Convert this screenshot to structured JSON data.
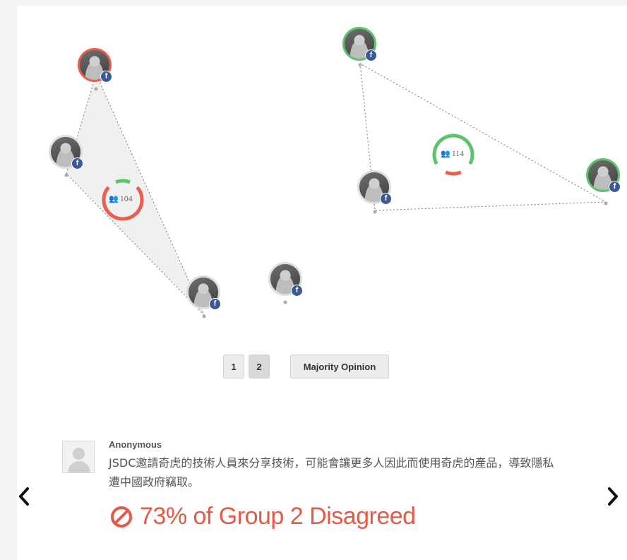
{
  "groups": [
    {
      "id": "g1",
      "count": "104",
      "agree_frac": 0.12,
      "disagree_frac": 0.73
    },
    {
      "id": "g2",
      "count": "114",
      "agree_frac": 0.66,
      "disagree_frac": 0.13
    }
  ],
  "participants": [
    {
      "id": "p1",
      "ring": "red",
      "badge": "f"
    },
    {
      "id": "p2",
      "ring": "plain",
      "badge": "f"
    },
    {
      "id": "p3",
      "ring": "plain",
      "badge": "f"
    },
    {
      "id": "p4",
      "ring": "plain",
      "badge": "f"
    },
    {
      "id": "p5",
      "ring": "green",
      "badge": "f"
    },
    {
      "id": "p6",
      "ring": "plain",
      "badge": "f"
    },
    {
      "id": "p7",
      "ring": "green",
      "badge": "f"
    }
  ],
  "pager": {
    "pages": [
      "1",
      "2"
    ],
    "active": "2",
    "majority_label": "Majority Opinion"
  },
  "comment": {
    "author": "Anonymous",
    "text": "JSDC邀請奇虎的技術人員來分享技術，可能會讓更多人因此而使用奇虎的產品，導致隱私遭中國政府竊取。",
    "verdict": "73% of Group 2 Disagreed"
  },
  "colors": {
    "agree": "#5cc46b",
    "disagree": "#e8604c",
    "fb": "#3b5998"
  },
  "icons": {
    "group": "people-icon",
    "verdict": "no-entry-icon",
    "prev": "chevron-left-icon",
    "next": "chevron-right-icon"
  }
}
